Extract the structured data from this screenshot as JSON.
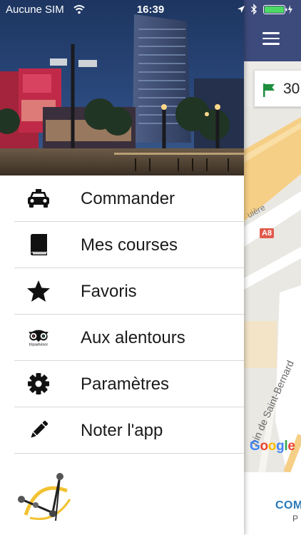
{
  "status_bar": {
    "carrier": "Aucune SIM",
    "time": "16:39"
  },
  "menu": {
    "items": [
      {
        "label": "Commander",
        "icon": "taxi-icon"
      },
      {
        "label": "Mes courses",
        "icon": "book-icon"
      },
      {
        "label": "Favoris",
        "icon": "star-icon"
      },
      {
        "label": "Aux alentours",
        "icon": "tripadvisor-icon"
      },
      {
        "label": "Paramètres",
        "icon": "gear-icon"
      },
      {
        "label": "Noter l'app",
        "icon": "pencil-icon"
      }
    ]
  },
  "tripadvisor_wordmark": "tripadvisor",
  "background_view": {
    "pickup_text": "30",
    "road_shield": "A8",
    "street_label_1": "uière",
    "street_label_2": "hin de Saint-Bernard",
    "map_attribution": "Google",
    "order_label": "COM",
    "order_sub": "P"
  },
  "colors": {
    "nav_bar": "#3d4a7c",
    "accent_blue": "#2a79b8",
    "flag_green": "#1e8e3e",
    "divider": "#d8d8d8"
  }
}
